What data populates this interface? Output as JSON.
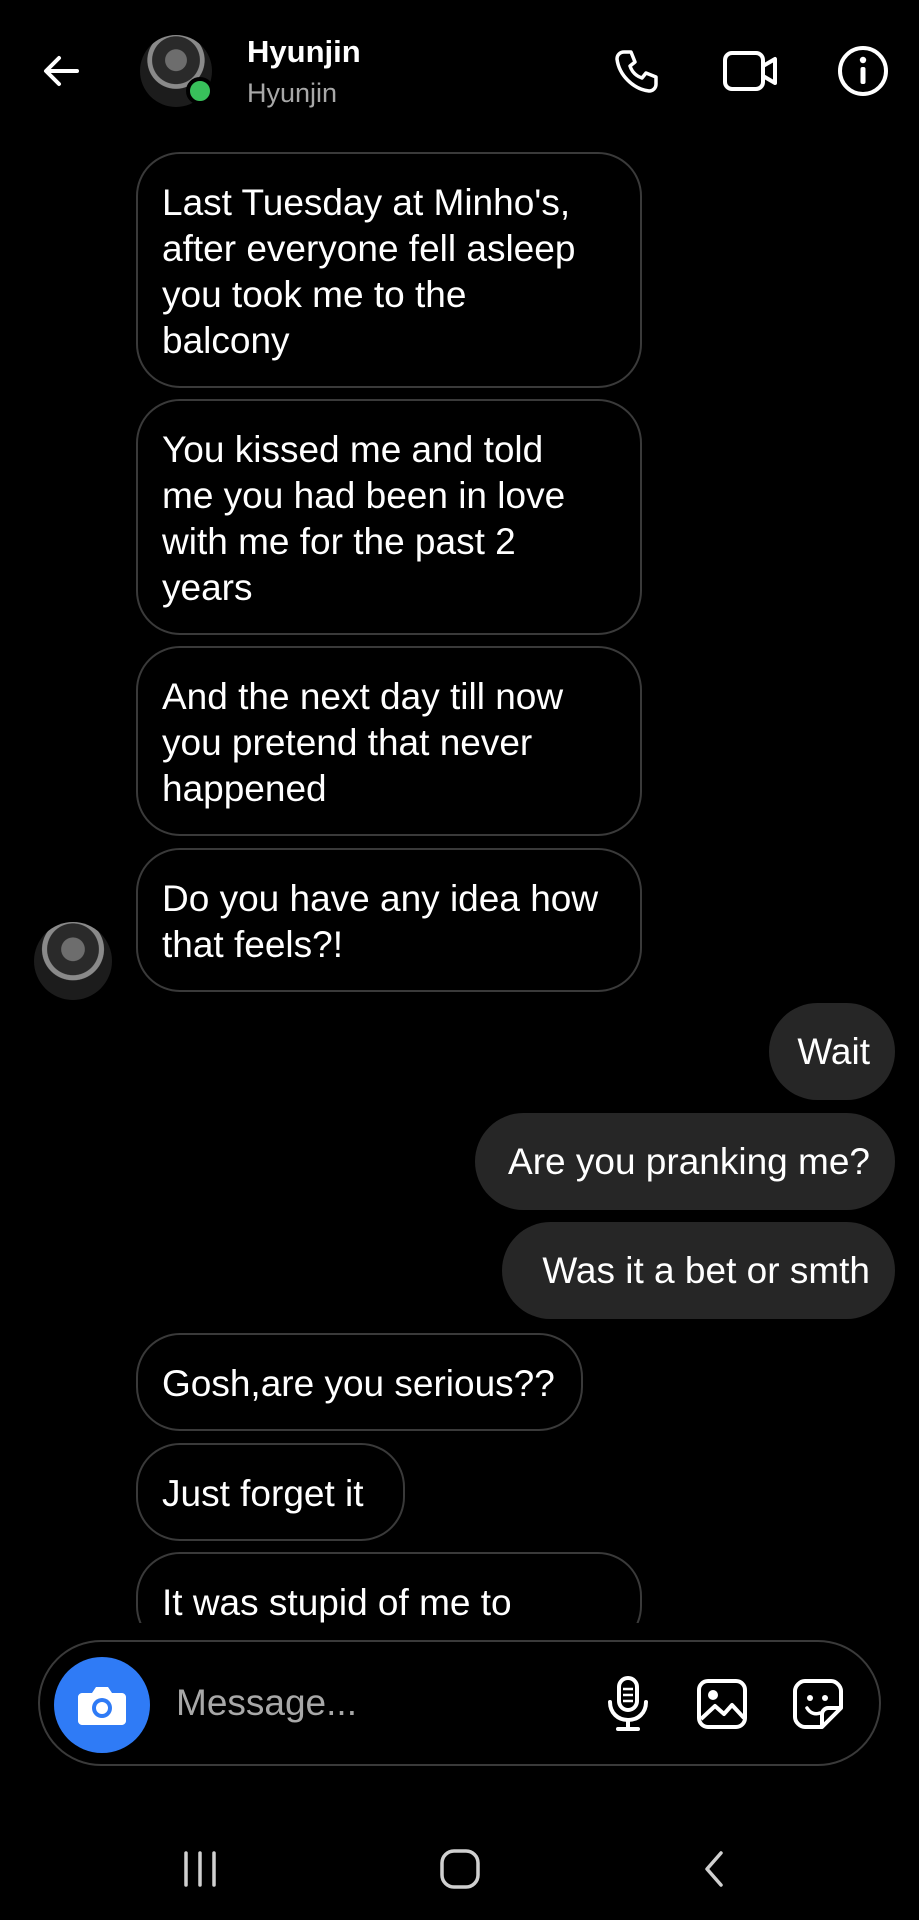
{
  "header": {
    "name": "Hyunjin",
    "username": "Hyunjin",
    "icons": [
      "back-arrow-icon",
      "phone-icon",
      "video-camera-icon",
      "info-icon"
    ]
  },
  "messages": [
    {
      "side": "received",
      "text": "Last Tuesday at Minho's,\nafter everyone fell asleep\nyou took me to the\nbalcony"
    },
    {
      "side": "received",
      "text": "You kissed me and told\nme you had been in love\nwith me for the past 2\nyears"
    },
    {
      "side": "received",
      "text": "And the next day till now\nyou pretend that never\nhappened"
    },
    {
      "side": "received",
      "text": "Do you have any idea how\nthat feels?!"
    },
    {
      "side": "sent",
      "text": "Wait"
    },
    {
      "side": "sent",
      "text": "Are you pranking me?"
    },
    {
      "side": "sent",
      "text": "Was it a bet or smth"
    },
    {
      "side": "received",
      "text": "Gosh,are you serious??"
    },
    {
      "side": "received",
      "text": "Just forget it"
    },
    {
      "side": "received",
      "text": "It was stupid of me to"
    }
  ],
  "composer": {
    "placeholder": "Message...",
    "icons": [
      "camera-icon",
      "microphone-icon",
      "gallery-icon",
      "sticker-icon"
    ]
  },
  "colors": {
    "background": "#000000",
    "sent_bubble": "#262626",
    "received_border": "#3a3a3a",
    "online": "#38c05b",
    "camera_button": "#2f7bf6",
    "secondary_text": "#a8a8a8"
  },
  "system_nav": {
    "icons": [
      "recents-icon",
      "home-icon",
      "back-icon"
    ]
  }
}
